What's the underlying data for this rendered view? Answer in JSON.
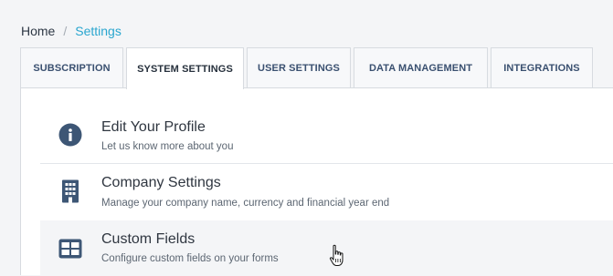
{
  "breadcrumb": {
    "home": "Home",
    "separator": "/",
    "current": "Settings"
  },
  "tabs": [
    {
      "label": "SUBSCRIPTION",
      "active": false
    },
    {
      "label": "SYSTEM SETTINGS",
      "active": true
    },
    {
      "label": "USER SETTINGS",
      "active": false
    },
    {
      "label": "DATA MANAGEMENT",
      "active": false
    },
    {
      "label": "INTEGRATIONS",
      "active": false
    }
  ],
  "settings_items": [
    {
      "icon": "info-circle-icon",
      "title": "Edit Your Profile",
      "description": "Let us know more about you"
    },
    {
      "icon": "building-icon",
      "title": "Company Settings",
      "description": "Manage your company name, currency and financial year end"
    },
    {
      "icon": "table-grid-icon",
      "title": "Custom Fields",
      "description": "Configure custom fields on your forms"
    }
  ],
  "colors": {
    "accent": "#2aa6cf",
    "icon": "#3d5675",
    "hover_row": "#f4f5f7"
  }
}
